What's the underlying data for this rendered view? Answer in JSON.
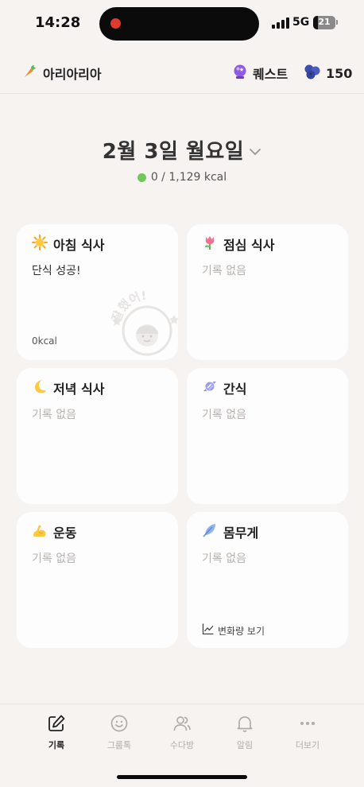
{
  "status_bar": {
    "time": "14:28",
    "network": "5G",
    "battery": "21",
    "battery_level": 0.21
  },
  "header": {
    "brand_name": "아리아리아",
    "brand_icon": "carrot-icon",
    "quest_label": "퀘스트",
    "quest_icon": "crystal-ball-icon",
    "points_value": "150",
    "points_icon": "blueberry-icon"
  },
  "date": {
    "title": "2월 3일 월요일",
    "kcal": "0 / 1,129 kcal",
    "kcal_dot_color": "#72c75c"
  },
  "cards": {
    "breakfast": {
      "title": "아침 식사",
      "icon": "sun-icon",
      "status": "단식 성공!",
      "kcal": "0kcal",
      "stamp_text": "잘했어!"
    },
    "lunch": {
      "title": "점심 식사",
      "icon": "tulip-icon",
      "status": "기록 없음"
    },
    "dinner": {
      "title": "저녁 식사",
      "icon": "crescent-moon-icon",
      "status": "기록 없음"
    },
    "snack": {
      "title": "간식",
      "icon": "candy-icon",
      "status": "기록 없음"
    },
    "exercise": {
      "title": "운동",
      "icon": "flexed-biceps-icon",
      "status": "기록 없음"
    },
    "weight": {
      "title": "몸무게",
      "icon": "feather-icon",
      "status": "기록 없음",
      "trend_label": "변화량 보기"
    }
  },
  "tabs": [
    {
      "label": "기록",
      "icon": "pencil-square-icon",
      "active": true
    },
    {
      "label": "그룹톡",
      "icon": "smiley-icon",
      "active": false
    },
    {
      "label": "수다방",
      "icon": "people-icon",
      "active": false
    },
    {
      "label": "알림",
      "icon": "bell-icon",
      "active": false
    },
    {
      "label": "더보기",
      "icon": "more-dots-icon",
      "active": false
    }
  ],
  "colors": {
    "background": "#f6f3f1",
    "card": "#fefdfd",
    "muted_text": "#b5b1ae",
    "accent_green": "#72c75c"
  }
}
